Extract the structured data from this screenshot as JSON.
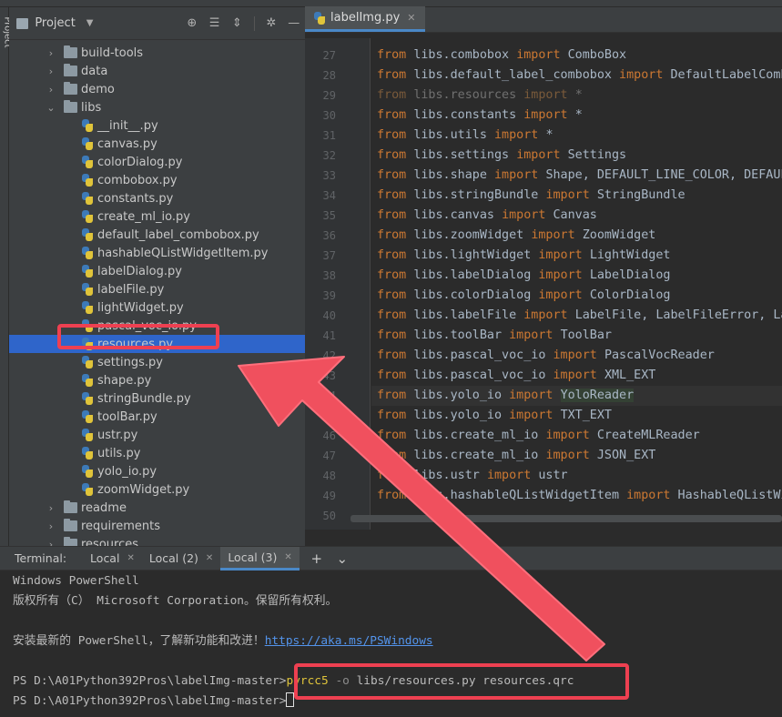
{
  "top": {
    "tool_label": "Project"
  },
  "project_panel": {
    "title": "Project",
    "tree": [
      {
        "label": "build-tools",
        "kind": "folder",
        "expanded": false
      },
      {
        "label": "data",
        "kind": "folder",
        "expanded": false
      },
      {
        "label": "demo",
        "kind": "folder",
        "expanded": false
      },
      {
        "label": "libs",
        "kind": "folder",
        "expanded": true
      },
      {
        "label": "__init__.py",
        "kind": "py"
      },
      {
        "label": "canvas.py",
        "kind": "py"
      },
      {
        "label": "colorDialog.py",
        "kind": "py"
      },
      {
        "label": "combobox.py",
        "kind": "py"
      },
      {
        "label": "constants.py",
        "kind": "py"
      },
      {
        "label": "create_ml_io.py",
        "kind": "py"
      },
      {
        "label": "default_label_combobox.py",
        "kind": "py"
      },
      {
        "label": "hashableQListWidgetItem.py",
        "kind": "py"
      },
      {
        "label": "labelDialog.py",
        "kind": "py"
      },
      {
        "label": "labelFile.py",
        "kind": "py"
      },
      {
        "label": "lightWidget.py",
        "kind": "py"
      },
      {
        "label": "pascal_voc_io.py",
        "kind": "py"
      },
      {
        "label": "resources.py",
        "kind": "py",
        "selected": true
      },
      {
        "label": "settings.py",
        "kind": "py"
      },
      {
        "label": "shape.py",
        "kind": "py"
      },
      {
        "label": "stringBundle.py",
        "kind": "py"
      },
      {
        "label": "toolBar.py",
        "kind": "py"
      },
      {
        "label": "ustr.py",
        "kind": "py"
      },
      {
        "label": "utils.py",
        "kind": "py"
      },
      {
        "label": "yolo_io.py",
        "kind": "py"
      },
      {
        "label": "zoomWidget.py",
        "kind": "py"
      },
      {
        "label": "readme",
        "kind": "folder",
        "expanded": false
      },
      {
        "label": "requirements",
        "kind": "folder",
        "expanded": false
      },
      {
        "label": "resources",
        "kind": "folder",
        "expanded": false
      }
    ]
  },
  "editor": {
    "tab_label": "labelImg.py",
    "lines": [
      {
        "n": "27",
        "mod": "libs.combobox",
        "imp": "ComboBox"
      },
      {
        "n": "28",
        "mod": "libs.default_label_combobox",
        "imp": "DefaultLabelComb"
      },
      {
        "n": "29",
        "mod": "libs.resources",
        "imp": "*",
        "dim": true
      },
      {
        "n": "30",
        "mod": "libs.constants",
        "imp": "*"
      },
      {
        "n": "31",
        "mod": "libs.utils",
        "imp": "*"
      },
      {
        "n": "32",
        "mod": "libs.settings",
        "imp": "Settings"
      },
      {
        "n": "33",
        "mod": "libs.shape",
        "imp": "Shape, DEFAULT_LINE_COLOR, DEFAUL"
      },
      {
        "n": "34",
        "mod": "libs.stringBundle",
        "imp": "StringBundle"
      },
      {
        "n": "35",
        "mod": "libs.canvas",
        "imp": "Canvas"
      },
      {
        "n": "36",
        "mod": "libs.zoomWidget",
        "imp": "ZoomWidget"
      },
      {
        "n": "37",
        "mod": "libs.lightWidget",
        "imp": "LightWidget"
      },
      {
        "n": "38",
        "mod": "libs.labelDialog",
        "imp": "LabelDialog"
      },
      {
        "n": "39",
        "mod": "libs.colorDialog",
        "imp": "ColorDialog"
      },
      {
        "n": "40",
        "mod": "libs.labelFile",
        "imp": "LabelFile, LabelFileError, La"
      },
      {
        "n": "41",
        "mod": "libs.toolBar",
        "imp": "ToolBar"
      },
      {
        "n": "42",
        "mod": "libs.pascal_voc_io",
        "imp": "PascalVocReader"
      },
      {
        "n": "43",
        "mod": "libs.pascal_voc_io",
        "imp": "XML_EXT"
      },
      {
        "n": "44",
        "mod": "libs.yolo_io",
        "imp": "YoloReader",
        "current": true
      },
      {
        "n": "45",
        "mod": "libs.yolo_io",
        "imp": "TXT_EXT"
      },
      {
        "n": "46",
        "mod": "libs.create_ml_io",
        "imp": "CreateMLReader"
      },
      {
        "n": "47",
        "mod": "libs.create_ml_io",
        "imp": "JSON_EXT"
      },
      {
        "n": "48",
        "mod": "libs.ustr",
        "imp": "ustr"
      },
      {
        "n": "49",
        "mod": "libs.hashableQListWidgetItem",
        "imp": "HashableQListWi"
      },
      {
        "n": "50",
        "mod": "",
        "imp": ""
      }
    ],
    "kw_from": "from",
    "kw_import": "import"
  },
  "terminal": {
    "label": "Terminal:",
    "tabs": [
      "Local",
      "Local (2)",
      "Local (3)"
    ],
    "active_tab": 2,
    "lines": {
      "l1": "Windows PowerShell",
      "l2": "版权所有（C） Microsoft Corporation。保留所有权利。",
      "l3_text": "安装最新的 PowerShell，了解新功能和改进！",
      "l3_link": "https://aka.ms/PSWindows",
      "prompt": "PS D:\\A01Python392Pros\\labelImg-master>",
      "cmd": "pyrcc5",
      "flag": "-o",
      "args": "libs/resources.py resources.qrc"
    }
  },
  "colors": {
    "annotation_red": "#ee4051",
    "selection_blue": "#2f65ca"
  }
}
